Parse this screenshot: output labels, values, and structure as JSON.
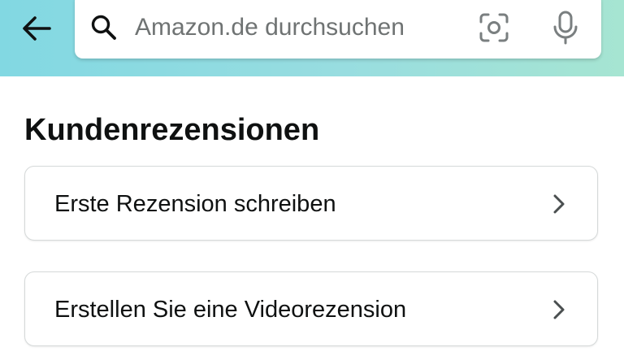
{
  "header": {
    "back_icon": "arrow-left-icon",
    "search": {
      "placeholder": "Amazon.de durchsuchen",
      "value": "",
      "search_icon": "search-icon",
      "camera_icon": "camera-scan-icon",
      "mic_icon": "microphone-icon"
    },
    "gradient_colors": [
      "#82d8e2",
      "#a6e5d2"
    ]
  },
  "main": {
    "section_title": "Kundenrezensionen",
    "actions": [
      {
        "label": "Erste Rezension schreiben",
        "icon": "chevron-right-icon"
      },
      {
        "label": "Erstellen Sie eine Videorezension",
        "icon": "chevron-right-icon"
      }
    ]
  }
}
